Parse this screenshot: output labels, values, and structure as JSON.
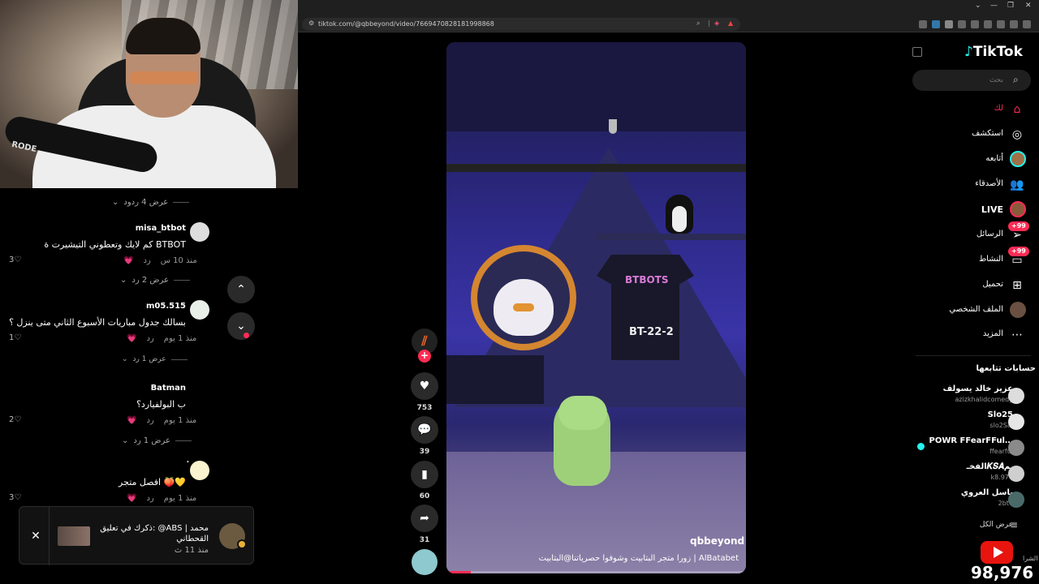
{
  "browser": {
    "url": "tiktok.com/@qbbeyond/video/7669470828181998868"
  },
  "webcam": {
    "mic_label": "RODE"
  },
  "comments": {
    "top_view_replies": "عرض 4 ردود",
    "items": [
      {
        "user": "misa_btbot",
        "text": "كم لايك وتعطوني التيشيرت ة BTBOT",
        "time": "منذ 10 س",
        "reply": "رد",
        "likes": "3",
        "view_replies": "عرض 2 رد"
      },
      {
        "user": "m05.515",
        "text": "بسالك جدول مباريات الأسبوع الثاني متى ينزل ؟",
        "time": "منذ 1 يوم",
        "reply": "رد",
        "likes": "1",
        "view_replies": "عرض 1 رد"
      },
      {
        "user": "Batman",
        "text": "ب البولفيارد؟",
        "time": "منذ 1 يوم",
        "reply": "رد",
        "likes": "2",
        "view_replies": "عرض 1 رد"
      },
      {
        "user": "ٔ",
        "text": "افصل متجر 🍑💛",
        "time": "منذ 1 يوم",
        "reply": "رد",
        "likes": "3",
        "view_replies": ""
      }
    ]
  },
  "toast": {
    "text": "ذكرك في تعليق: @ABS | محمد القحطاني",
    "time": "منذ 11 ث"
  },
  "video": {
    "username": "qbbeyond",
    "description": "زورا متجر البتابيت وشوفوا حصرياتنا@البتابيت | AlBatabet",
    "shirt_text": "BTBOTS",
    "shirt_text2": "BT-22-2",
    "progress": 0.08,
    "likes": "753",
    "comments": "39",
    "saves": "60",
    "shares": "31"
  },
  "sidebar": {
    "logo": "TikTok",
    "search_placeholder": "بحث",
    "nav": [
      {
        "label": "لك",
        "icon": "home-icon"
      },
      {
        "label": "استكشف",
        "icon": "compass-icon"
      },
      {
        "label": "أتابعه",
        "icon": "following-avatar"
      },
      {
        "label": "الأصدقاء",
        "icon": "friends-icon"
      },
      {
        "label": "LIVE",
        "icon": "live-avatar"
      },
      {
        "label": "الرسائل",
        "icon": "messages-icon",
        "badge": "+99"
      },
      {
        "label": "النشاط",
        "icon": "activity-icon",
        "badge": "+99"
      },
      {
        "label": "تحميل",
        "icon": "upload-icon"
      },
      {
        "label": "الملف الشخصي",
        "icon": "profile-avatar"
      },
      {
        "label": "المزيد",
        "icon": "more-icon"
      }
    ],
    "following_header": "حسابات تتابعها",
    "accounts": [
      {
        "name": "عزيز خالد يسولف",
        "handle": "azizkhalidcomedy"
      },
      {
        "name": "Slo25",
        "handle": "slo2Sal"
      },
      {
        "name": "POWR FFearFFul…",
        "handle": "ffearful",
        "live": true
      },
      {
        "name": "الفخـ𝑲𝑺𝑨ـم",
        "handle": "k8.977"
      },
      {
        "name": "باسل العروي",
        "handle": "2bt7"
      }
    ],
    "see_all": "عرض الكل",
    "yt_label": "الشرا",
    "subscriber_count": "98,976"
  }
}
